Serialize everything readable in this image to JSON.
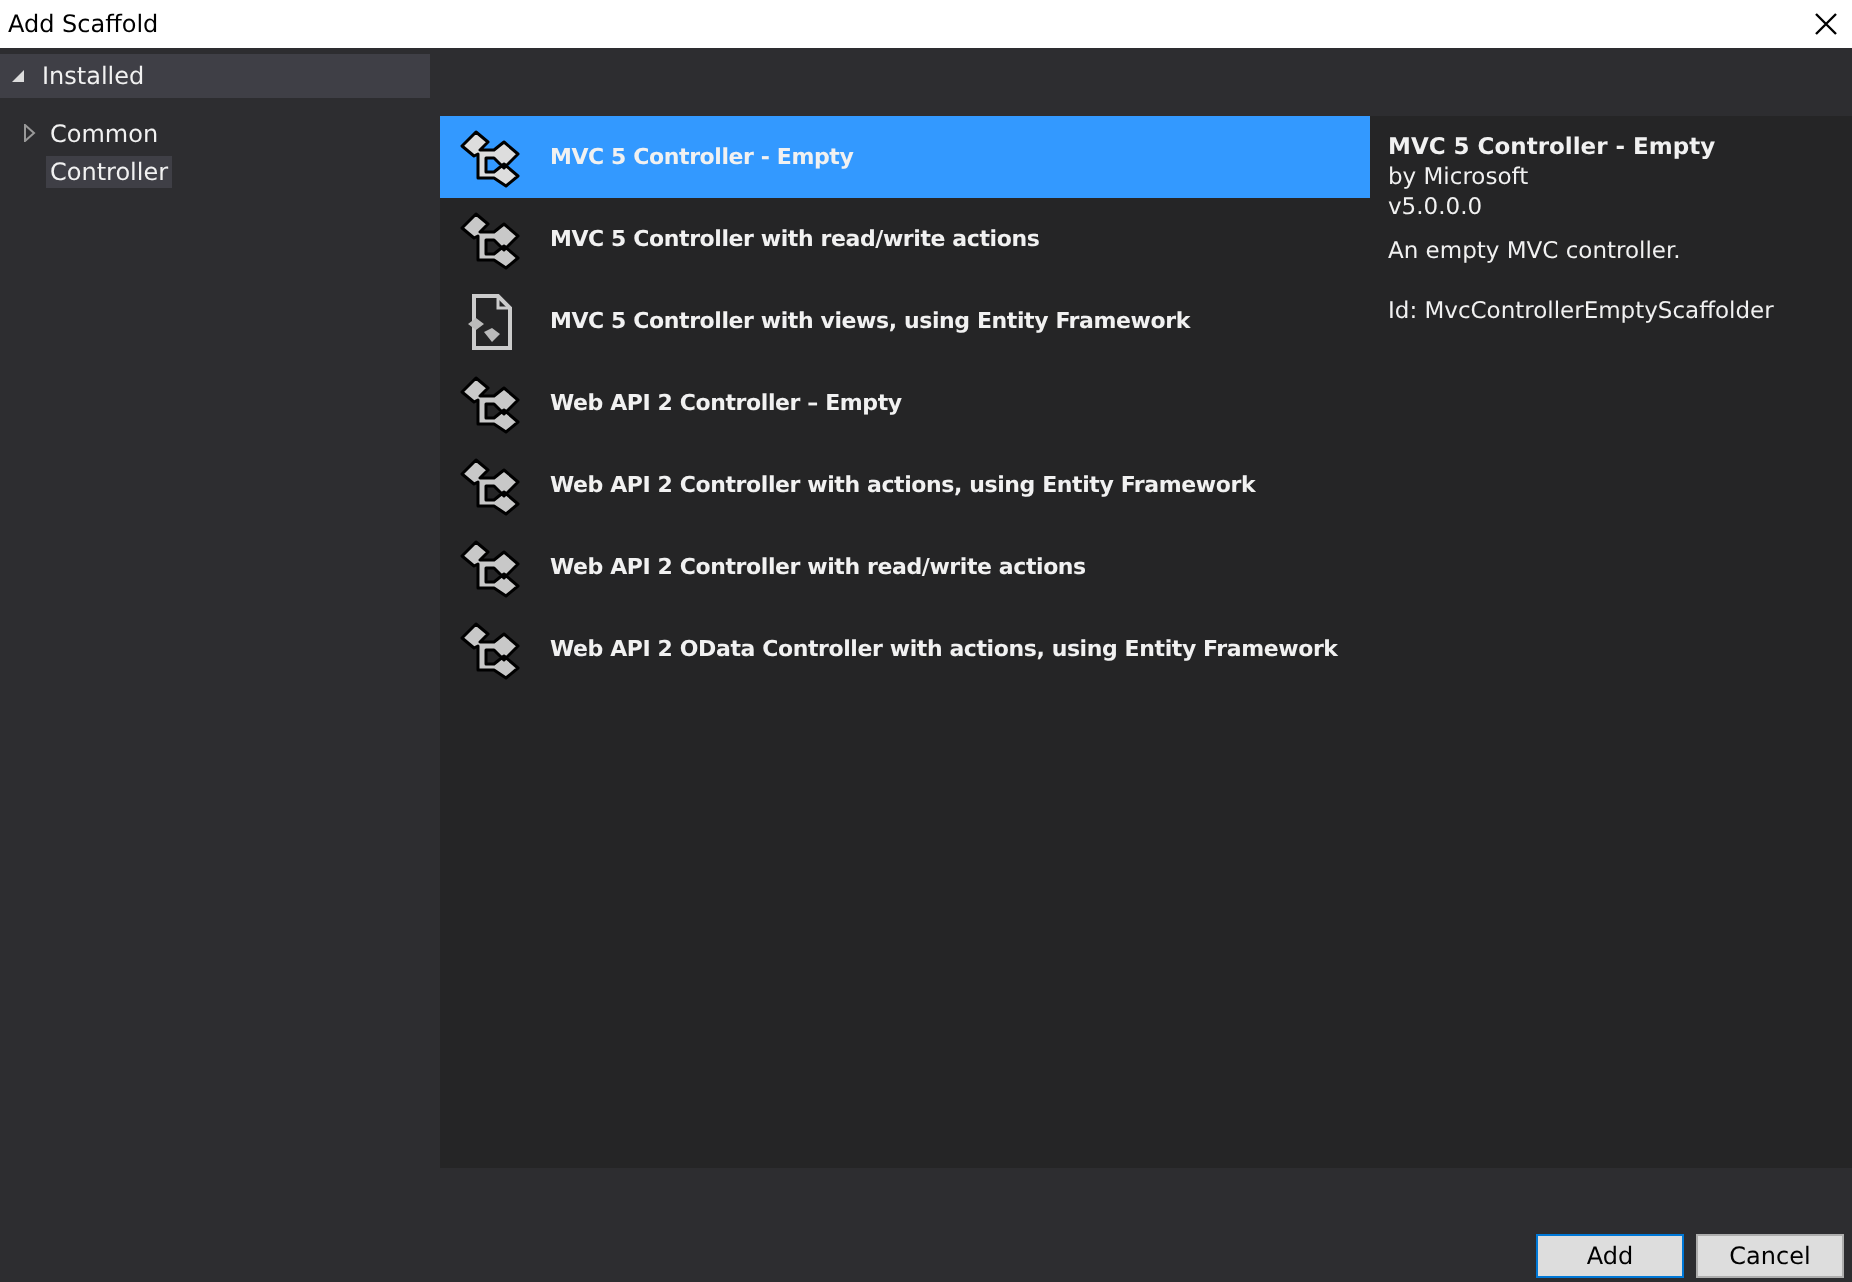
{
  "window": {
    "title": "Add Scaffold"
  },
  "tree": {
    "label": "Installed",
    "expanded": true,
    "children": [
      {
        "label": "Common",
        "expanded": false,
        "selected": false
      },
      {
        "label": "Controller",
        "selected": true
      }
    ]
  },
  "templates": [
    {
      "label": "MVC 5 Controller - Empty",
      "kind": "controller",
      "selected": true
    },
    {
      "label": "MVC 5 Controller with read/write actions",
      "kind": "controller",
      "selected": false
    },
    {
      "label": "MVC 5 Controller with views, using Entity Framework",
      "kind": "views",
      "selected": false
    },
    {
      "label": "Web API 2 Controller – Empty",
      "kind": "controller",
      "selected": false
    },
    {
      "label": "Web API 2 Controller with actions, using Entity Framework",
      "kind": "controller",
      "selected": false
    },
    {
      "label": "Web API 2 Controller with read/write actions",
      "kind": "controller",
      "selected": false
    },
    {
      "label": "Web API 2 OData Controller with actions, using Entity Framework",
      "kind": "controller",
      "selected": false
    }
  ],
  "details": {
    "title": "MVC 5 Controller - Empty",
    "author": "by Microsoft",
    "version": "v5.0.0.0",
    "description": "An empty MVC controller.",
    "id": "Id: MvcControllerEmptyScaffolder"
  },
  "buttons": [
    {
      "label": "Add",
      "default": true
    },
    {
      "label": "Cancel",
      "default": false
    }
  ]
}
